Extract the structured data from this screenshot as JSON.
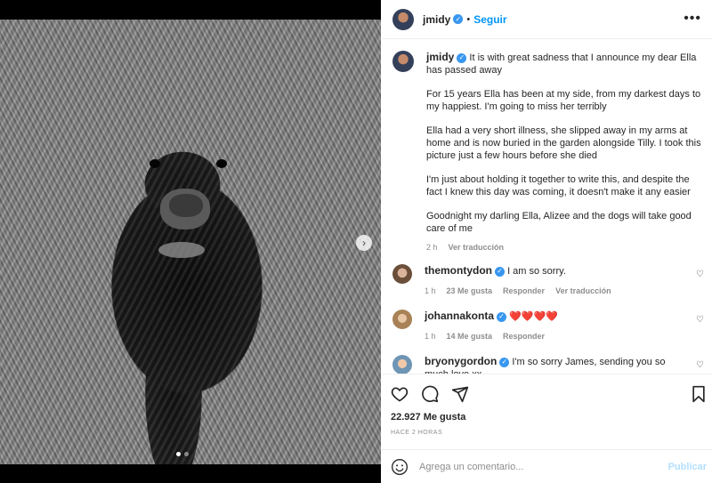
{
  "post": {
    "author": "jmidy",
    "follow_label": "Seguir",
    "more_icon": "more-options-icon",
    "caption": {
      "lead": "It is with great sadness that I announce my dear Ella has passed away",
      "paragraphs": [
        "For 15 years Ella has been at my side, from my darkest days to my happiest. I'm going to miss her terribly",
        "Ella had a very short illness, she slipped away in my arms at home and is now buried in the garden alongside Tilly. I took this picture just a few hours before she died",
        "I'm just about holding it together to write this, and despite the fact I knew this day was coming, it doesn't make it any easier",
        "Goodnight my darling Ella, Alizee and the dogs will take good care of me"
      ],
      "age": "2 h",
      "translate": "Ver traducción"
    },
    "comments": [
      {
        "user": "themontydon",
        "text": "I am so sorry.",
        "age": "1 h",
        "likes": "23 Me gusta",
        "reply": "Responder",
        "translate": "Ver traducción"
      },
      {
        "user": "johannakonta",
        "text": "❤️❤️❤️❤️",
        "age": "1 h",
        "likes": "14 Me gusta",
        "reply": "Responder"
      },
      {
        "user": "bryonygordon",
        "text": "I'm so sorry James, sending you so much love xx"
      }
    ],
    "likes_count": "22.927 Me gusta",
    "timestamp": "HACE 2 HORAS",
    "comment_placeholder": "Agrega un comentario...",
    "publish_label": "Publicar"
  },
  "colors": {
    "accent": "#0095f6",
    "verified": "#3897f0",
    "publish_disabled": "#b2dffc",
    "heart": "#ed4956"
  }
}
